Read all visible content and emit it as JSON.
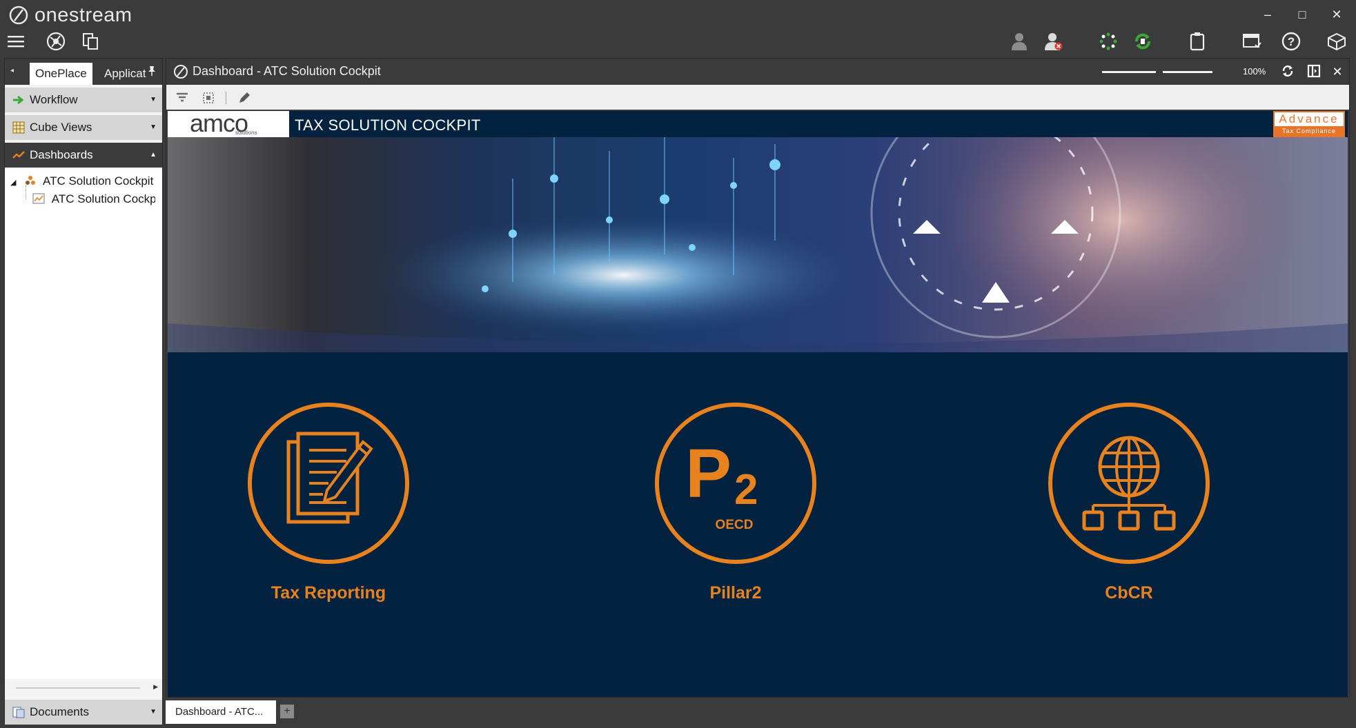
{
  "app": {
    "brand": "onestream"
  },
  "window": {
    "minimize": "–",
    "maximize": "□",
    "close": "✕"
  },
  "toolbar_icons": [
    "menu-icon",
    "globe-settings-icon",
    "document-copy-icon",
    "user-icon",
    "user-error-icon",
    "loading-spinner-icon",
    "refresh-green-icon",
    "clipboard-icon",
    "task-window-icon",
    "help-icon",
    "cube-icon"
  ],
  "left_panel": {
    "tabs": [
      {
        "label": "OnePlace"
      },
      {
        "label": "Applicat"
      }
    ],
    "workflow": {
      "label": "Workflow"
    },
    "cube_views": {
      "label": "Cube Views"
    },
    "dashboards": {
      "label": "Dashboards"
    },
    "tree": [
      {
        "label": "ATC Solution Cockpit",
        "level": 0,
        "icon": "dashboard-group-icon"
      },
      {
        "label": "ATC Solution Cockp",
        "level": 1,
        "icon": "dashboard-chart-icon"
      }
    ],
    "documents": {
      "label": "Documents"
    }
  },
  "main": {
    "title": "Dashboard - ATC Solution Cockpit",
    "zoom": "100%",
    "header": {
      "brand": "amco",
      "brand_sub": "solutions",
      "title": "TAX SOLUTION COCKPIT",
      "partner_word": "Advance",
      "partner_sub": "Tax Compliance"
    },
    "pillar_text": {
      "big": "P",
      "sub": "2",
      "caption": "OECD"
    },
    "tiles": [
      {
        "label": "Tax Reporting",
        "icon": "tax-document-pen-icon"
      },
      {
        "label": "Pillar2",
        "icon": "pillar2-oecd-icon"
      },
      {
        "label": "CbCR",
        "icon": "globe-network-icon"
      }
    ]
  },
  "bottom_tabs": [
    {
      "label": "Dashboard - ATC..."
    }
  ],
  "add_tab": "+",
  "colors": {
    "accent": "#e8821e",
    "content_bg": "#03223f",
    "chrome": "#3b3b3b",
    "green": "#3aa935"
  }
}
